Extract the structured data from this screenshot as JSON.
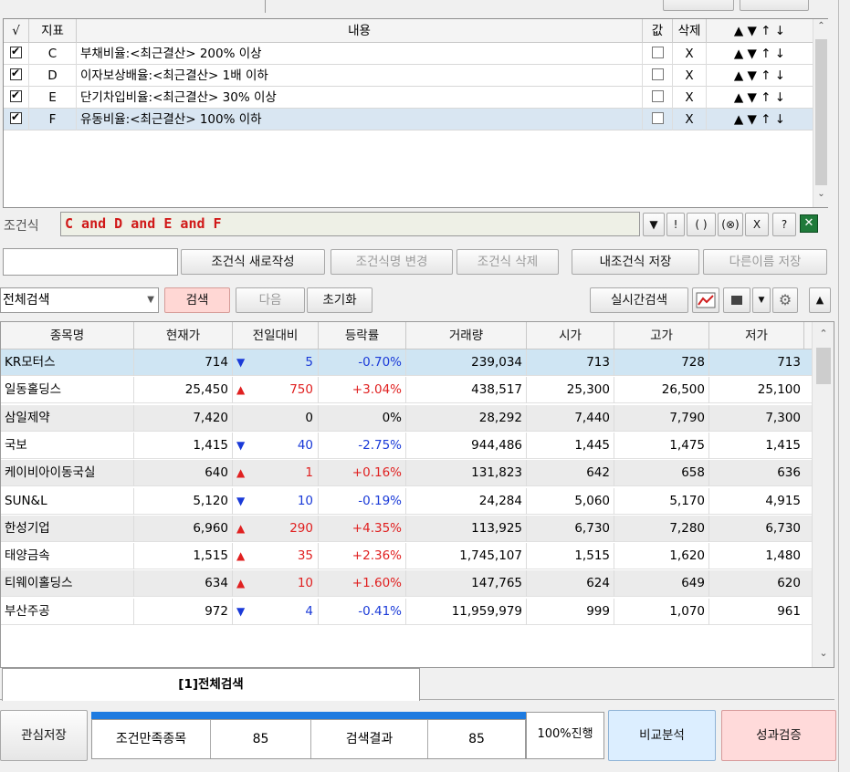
{
  "condition_table": {
    "headers": {
      "check": "√",
      "index": "지표",
      "content": "내용",
      "value": "값",
      "delete": "삭제",
      "arrows": "▲ ▼ ↑ ↓"
    },
    "rows": [
      {
        "checked": true,
        "index": "C",
        "content": "부채비율:<최근결산> 200% 이상",
        "delete": "X",
        "arrows": "▲ ▼ ↑ ↓"
      },
      {
        "checked": true,
        "index": "D",
        "content": "이자보상배율:<최근결산> 1배 이하",
        "delete": "X",
        "arrows": "▲ ▼ ↑ ↓"
      },
      {
        "checked": true,
        "index": "E",
        "content": "단기차입비율:<최근결산> 30% 이상",
        "delete": "X",
        "arrows": "▲ ▼ ↑ ↓"
      },
      {
        "checked": true,
        "index": "F",
        "content": "유동비율:<최근결산> 100% 이하",
        "delete": "X",
        "arrows": "▲ ▼ ↑ ↓"
      }
    ]
  },
  "formula": {
    "label": "조건식",
    "value": "C and D and E and F",
    "buttons": [
      "▼",
      "!",
      "( )",
      "(⊗)",
      "X",
      "?"
    ]
  },
  "formula_actions": {
    "new": "조건식 새로작성",
    "rename": "조건식명 변경",
    "delete": "조건식 삭제",
    "save": "내조건식 저장",
    "save_as": "다른이름 저장"
  },
  "search_bar": {
    "scope": "전체검색",
    "search": "검색",
    "next": "다음",
    "reset": "초기화",
    "realtime": "실시간검색"
  },
  "results": {
    "headers": [
      "종목명",
      "현재가",
      "전일대비",
      "등락률",
      "거래량",
      "시가",
      "고가",
      "저가"
    ],
    "rows": [
      {
        "name": "KR모터스",
        "price": "714",
        "dir": "down",
        "change": "5",
        "rate": "-0.70%",
        "volume": "239,034",
        "open": "713",
        "high": "728",
        "low": "713"
      },
      {
        "name": "일동홀딩스",
        "price": "25,450",
        "dir": "up",
        "change": "750",
        "rate": "+3.04%",
        "volume": "438,517",
        "open": "25,300",
        "high": "26,500",
        "low": "25,100"
      },
      {
        "name": "삼일제약",
        "price": "7,420",
        "dir": "flat",
        "change": "0",
        "rate": "0%",
        "volume": "28,292",
        "open": "7,440",
        "high": "7,790",
        "low": "7,300"
      },
      {
        "name": "국보",
        "price": "1,415",
        "dir": "down",
        "change": "40",
        "rate": "-2.75%",
        "volume": "944,486",
        "open": "1,445",
        "high": "1,475",
        "low": "1,415"
      },
      {
        "name": "케이비아이동국실",
        "price": "640",
        "dir": "up",
        "change": "1",
        "rate": "+0.16%",
        "volume": "131,823",
        "open": "642",
        "high": "658",
        "low": "636"
      },
      {
        "name": "SUN&L",
        "price": "5,120",
        "dir": "down",
        "change": "10",
        "rate": "-0.19%",
        "volume": "24,284",
        "open": "5,060",
        "high": "5,170",
        "low": "4,915"
      },
      {
        "name": "한성기업",
        "price": "6,960",
        "dir": "up",
        "change": "290",
        "rate": "+4.35%",
        "volume": "113,925",
        "open": "6,730",
        "high": "7,280",
        "low": "6,730"
      },
      {
        "name": "태양금속",
        "price": "1,515",
        "dir": "up",
        "change": "35",
        "rate": "+2.36%",
        "volume": "1,745,107",
        "open": "1,515",
        "high": "1,620",
        "low": "1,480"
      },
      {
        "name": "티웨이홀딩스",
        "price": "634",
        "dir": "up",
        "change": "10",
        "rate": "+1.60%",
        "volume": "147,765",
        "open": "624",
        "high": "649",
        "low": "620"
      },
      {
        "name": "부산주공",
        "price": "972",
        "dir": "down",
        "change": "4",
        "rate": "-0.41%",
        "volume": "11,959,979",
        "open": "999",
        "high": "1,070",
        "low": "961"
      }
    ]
  },
  "bottom_tab": {
    "label": "[1]전체검색"
  },
  "footer": {
    "save_watch": "관심저장",
    "matched_label": "조건만족종목",
    "matched_value": "85",
    "result_label": "검색결과",
    "result_value": "85",
    "progress": "100%진행",
    "compare": "비교분석",
    "verify": "성과검증"
  },
  "colors": {
    "up": "#e02020",
    "down": "#1a3ad8",
    "selected_row": "#cfe5f3",
    "alt_row": "#ebebeb",
    "progress_fill": "#1e7be0"
  }
}
